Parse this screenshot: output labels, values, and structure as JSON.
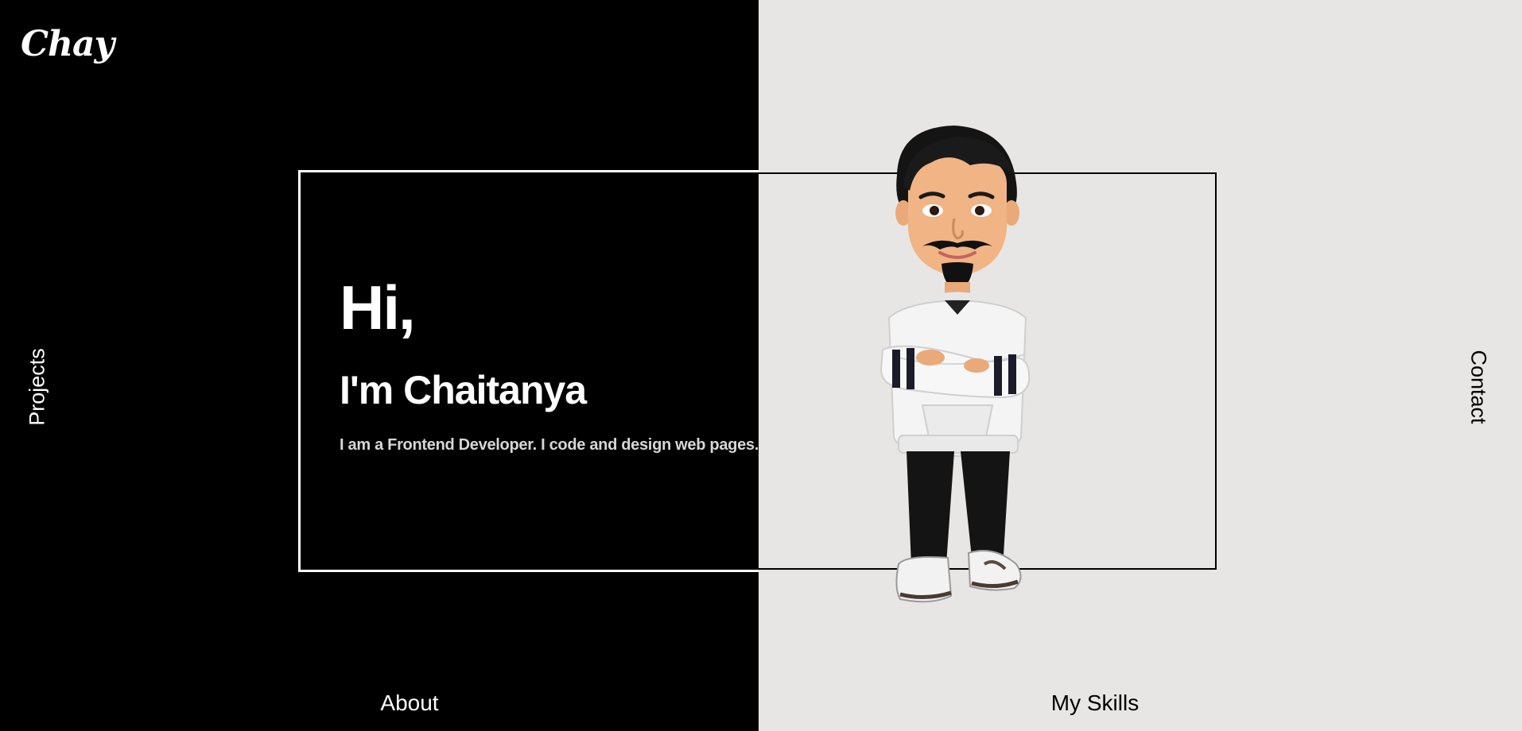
{
  "brand": {
    "logo": "Chay"
  },
  "hero": {
    "greeting": "Hi,",
    "name": "I'm Chaitanya",
    "tagline": "I am a Frontend Developer. I code and design web pages."
  },
  "nav": {
    "projects": "Projects",
    "contact": "Contact",
    "about": "About",
    "skills": "My Skills"
  },
  "avatar": {
    "icon": "cartoon-avatar-illustration"
  },
  "colors": {
    "dark_panel": "#000000",
    "light_panel": "#e7e6e4",
    "text_light": "#ffffff",
    "text_dark": "#000000"
  }
}
